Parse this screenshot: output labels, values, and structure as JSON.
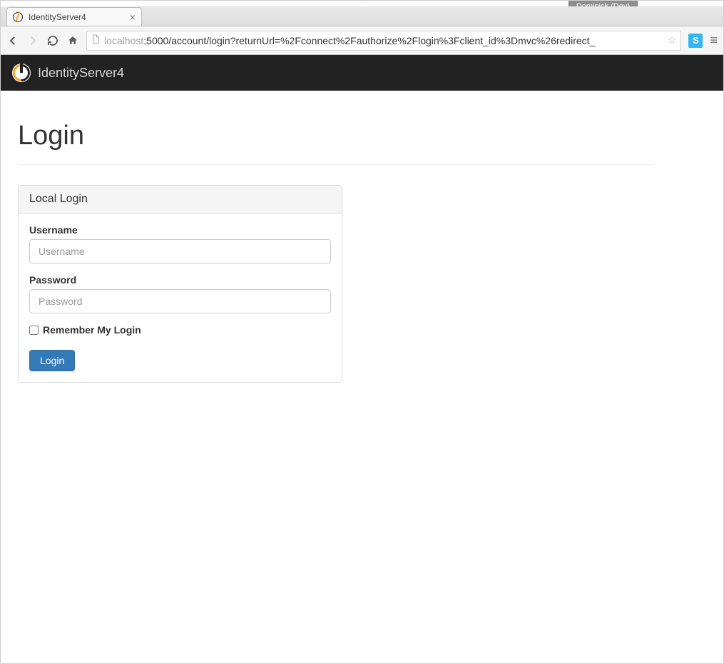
{
  "window": {
    "user_label": "Dominick (Dev)"
  },
  "browser": {
    "tab_title": "IdentityServer4",
    "url_host": "localhost",
    "url_path": ":5000/account/login?returnUrl=%2Fconnect%2Fauthorize%2Flogin%3Fclient_id%3Dmvc%26redirect_"
  },
  "navbar": {
    "brand": "IdentityServer4"
  },
  "page": {
    "title": "Login"
  },
  "panel": {
    "heading": "Local Login",
    "username_label": "Username",
    "username_placeholder": "Username",
    "password_label": "Password",
    "password_placeholder": "Password",
    "remember_label": "Remember My Login",
    "submit_label": "Login"
  }
}
